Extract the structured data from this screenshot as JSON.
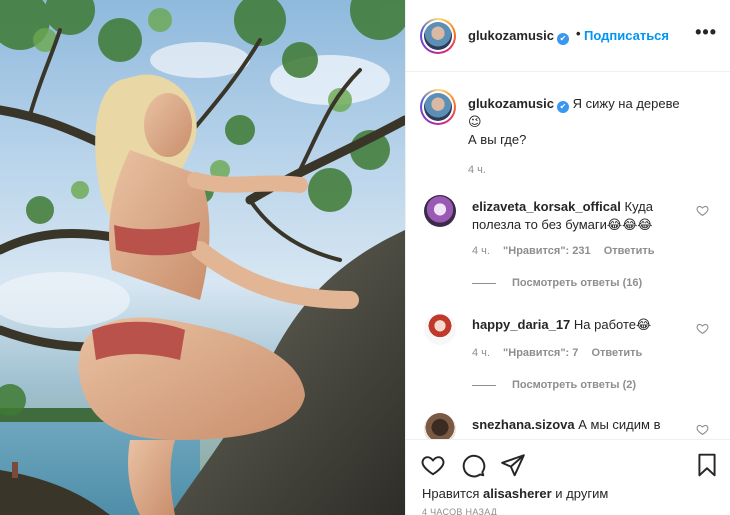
{
  "header": {
    "username": "glukozamusic",
    "separator": "•",
    "follow_label": "Подписаться",
    "more_label": "•••"
  },
  "caption": {
    "username": "glukozamusic",
    "line1": "Я сижу на дереве",
    "emoji": "😉",
    "line2": "А вы где?",
    "time": "4 ч."
  },
  "comments": [
    {
      "username": "elizaveta_korsak_offical",
      "text": "Куда полезла то без бумаги😂😂😂",
      "time": "4 ч.",
      "likes": "\"Нравится\": 231",
      "reply_label": "Ответить",
      "view_replies": "Посмотреть ответы (16)"
    },
    {
      "username": "happy_daria_17",
      "text": "На работе😂",
      "time": "4 ч.",
      "likes": "\"Нравится\": 7",
      "reply_label": "Ответить",
      "view_replies": "Посмотреть ответы (2)"
    },
    {
      "username": "snezhana.sizova",
      "text": "А мы сидим в"
    }
  ],
  "likes_line": {
    "prefix": "Нравится",
    "user": "alisasherer",
    "suffix": "и другим"
  },
  "posted_ago": "4 ЧАСОВ НАЗАД",
  "icons": [
    "heart-icon",
    "comment-icon",
    "share-icon",
    "bookmark-icon",
    "more-icon",
    "verified-icon"
  ],
  "colors": {
    "follow": "#0095f6",
    "verified": "#3897f0",
    "muted": "#8e8e8e",
    "text": "#262626"
  }
}
